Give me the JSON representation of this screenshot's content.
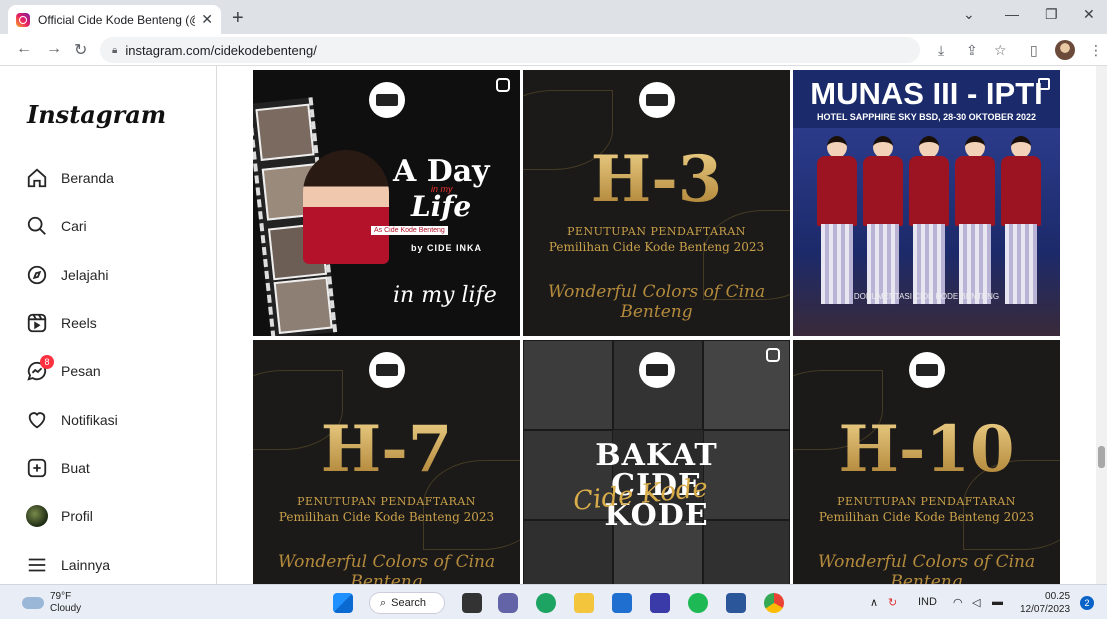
{
  "browser": {
    "tab_title": "Official Cide Kode Benteng (@cid",
    "url": "instagram.com/cidekodebenteng/"
  },
  "sidebar": {
    "logo": "Instagram",
    "items": [
      {
        "label": "Beranda",
        "icon": "home-icon"
      },
      {
        "label": "Cari",
        "icon": "search-icon"
      },
      {
        "label": "Jelajahi",
        "icon": "compass-icon"
      },
      {
        "label": "Reels",
        "icon": "reels-icon"
      },
      {
        "label": "Pesan",
        "icon": "messenger-icon",
        "badge": "8"
      },
      {
        "label": "Notifikasi",
        "icon": "heart-icon"
      },
      {
        "label": "Buat",
        "icon": "plus-square-icon"
      },
      {
        "label": "Profil",
        "icon": "profile-avatar"
      },
      {
        "label": "Lainnya",
        "icon": "menu-icon"
      }
    ]
  },
  "posts": {
    "p1": {
      "title_a": "A Day",
      "in_my": "in my",
      "life": "Life",
      "as": "As Cide Kode Benteng",
      "by": "by CIDE INKA",
      "script": "in my life"
    },
    "p2": {
      "big": "H-3",
      "line1": "PENUTUPAN PENDAFTARAN",
      "line2": "Pemilihan Cide Kode Benteng 2023",
      "script": "Wonderful Colors of Cina Benteng"
    },
    "p3": {
      "title": "MUNAS III - IPTI",
      "hotel": "HOTEL SAPPHIRE SKY BSD, 28-30 OKTOBER 2022",
      "doc": "DOKUMENTASI CIDE KODE BENTENG"
    },
    "p4": {
      "big": "H-7",
      "line1": "PENUTUPAN PENDAFTARAN",
      "line2": "Pemilihan Cide Kode Benteng 2023",
      "script": "Wonderful Colors of Cina Benteng"
    },
    "p5": {
      "l1": "BAKAT",
      "l2": "CIDE",
      "l3": "KODE",
      "script": "Cide Kode"
    },
    "p6": {
      "big": "H-10",
      "line1": "PENUTUPAN PENDAFTARAN",
      "line2": "Pemilihan Cide Kode Benteng 2023",
      "script": "Wonderful Colors of Cina Benteng"
    }
  },
  "taskbar": {
    "temp": "79°F",
    "condition": "Cloudy",
    "search": "Search",
    "lang": "IND",
    "time": "00.25",
    "date": "12/07/2023",
    "notifications": "2"
  },
  "colors": {
    "accent_gold": "#c9a04a",
    "badge_red": "#ff3040",
    "kebaya_red": "#9c1422"
  }
}
